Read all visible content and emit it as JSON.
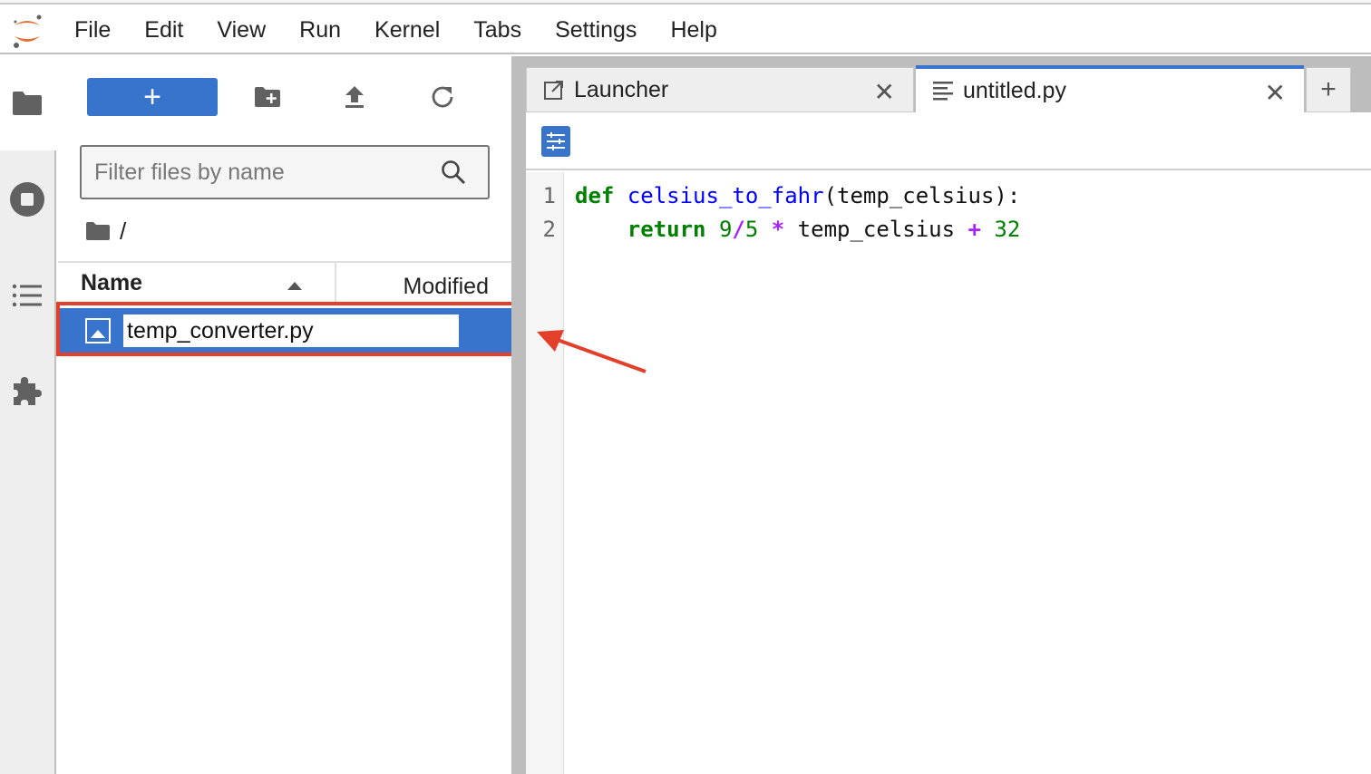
{
  "menubar": {
    "logo": "jupyter-logo",
    "items": [
      "File",
      "Edit",
      "View",
      "Run",
      "Kernel",
      "Tabs",
      "Settings",
      "Help"
    ]
  },
  "left_sidebar": {
    "icons": [
      "folder-icon",
      "running-stop-icon",
      "table-of-contents-icon",
      "extension-puzzle-icon"
    ]
  },
  "file_browser": {
    "new_button_label": "+",
    "toolbar_icons": [
      "new-folder-icon",
      "upload-icon",
      "refresh-icon"
    ],
    "filter_placeholder": "Filter files by name",
    "filter_value": "",
    "breadcrumb": "/",
    "columns": {
      "name": "Name",
      "modified": "Modified"
    },
    "files": [
      {
        "name": "temp_converter.py",
        "editing": true,
        "selected": true
      }
    ]
  },
  "tabs": [
    {
      "label": "Launcher",
      "icon": "launcher-icon",
      "active": false
    },
    {
      "label": "untitled.py",
      "icon": "text-file-icon",
      "active": true
    }
  ],
  "tab_close_glyph": "✕",
  "tab_add_glyph": "+",
  "editor": {
    "line_numbers": [
      "1",
      "2"
    ],
    "lines": [
      [
        {
          "t": "def",
          "c": "kw"
        },
        {
          "t": " ",
          "c": ""
        },
        {
          "t": "celsius_to_fahr",
          "c": "fn"
        },
        {
          "t": "(temp_celsius):",
          "c": ""
        }
      ],
      [
        {
          "t": "    ",
          "c": ""
        },
        {
          "t": "return",
          "c": "kw"
        },
        {
          "t": " ",
          "c": ""
        },
        {
          "t": "9",
          "c": "num"
        },
        {
          "t": "/",
          "c": "op"
        },
        {
          "t": "5",
          "c": "num"
        },
        {
          "t": " ",
          "c": ""
        },
        {
          "t": "*",
          "c": "op"
        },
        {
          "t": " temp_celsius ",
          "c": ""
        },
        {
          "t": "+",
          "c": "op"
        },
        {
          "t": " ",
          "c": ""
        },
        {
          "t": "32",
          "c": "num"
        }
      ]
    ]
  },
  "colors": {
    "accent": "#3874cc",
    "annotation": "#e2402b"
  }
}
